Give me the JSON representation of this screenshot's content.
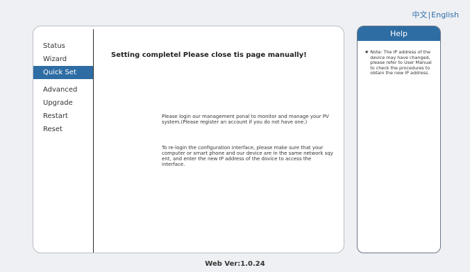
{
  "lang": {
    "chinese": "中文",
    "separator": "|",
    "english": "English"
  },
  "menu": {
    "items": [
      {
        "label": "Status"
      },
      {
        "label": "Wizard"
      },
      {
        "label": "Quick Set"
      },
      {
        "label": "Advanced"
      },
      {
        "label": "Upgrade"
      },
      {
        "label": "Restart"
      },
      {
        "label": "Reset"
      }
    ],
    "active": "Quick Set"
  },
  "content": {
    "heading": "Setting completel Please close tis page manually!",
    "para1": "Please login our management ponal to monitor and manage your PV system.(Please register an account if you do not have one.)",
    "para2": "To re-login the configuration interface, please make sure that your computer or srnart phone and our device are in the same network sqy ent, and enter the new IP address of the dovice to access the interface."
  },
  "help": {
    "title": "Help",
    "star": "★",
    "note": "Note: The IP address of the device may have changed, please refer to User Manual to check the procedures to obtain the new IP address."
  },
  "footer": {
    "version": "Web Ver:1.0.24"
  },
  "colors": {
    "accent": "#2e6da4",
    "background": "#eef0f3"
  }
}
